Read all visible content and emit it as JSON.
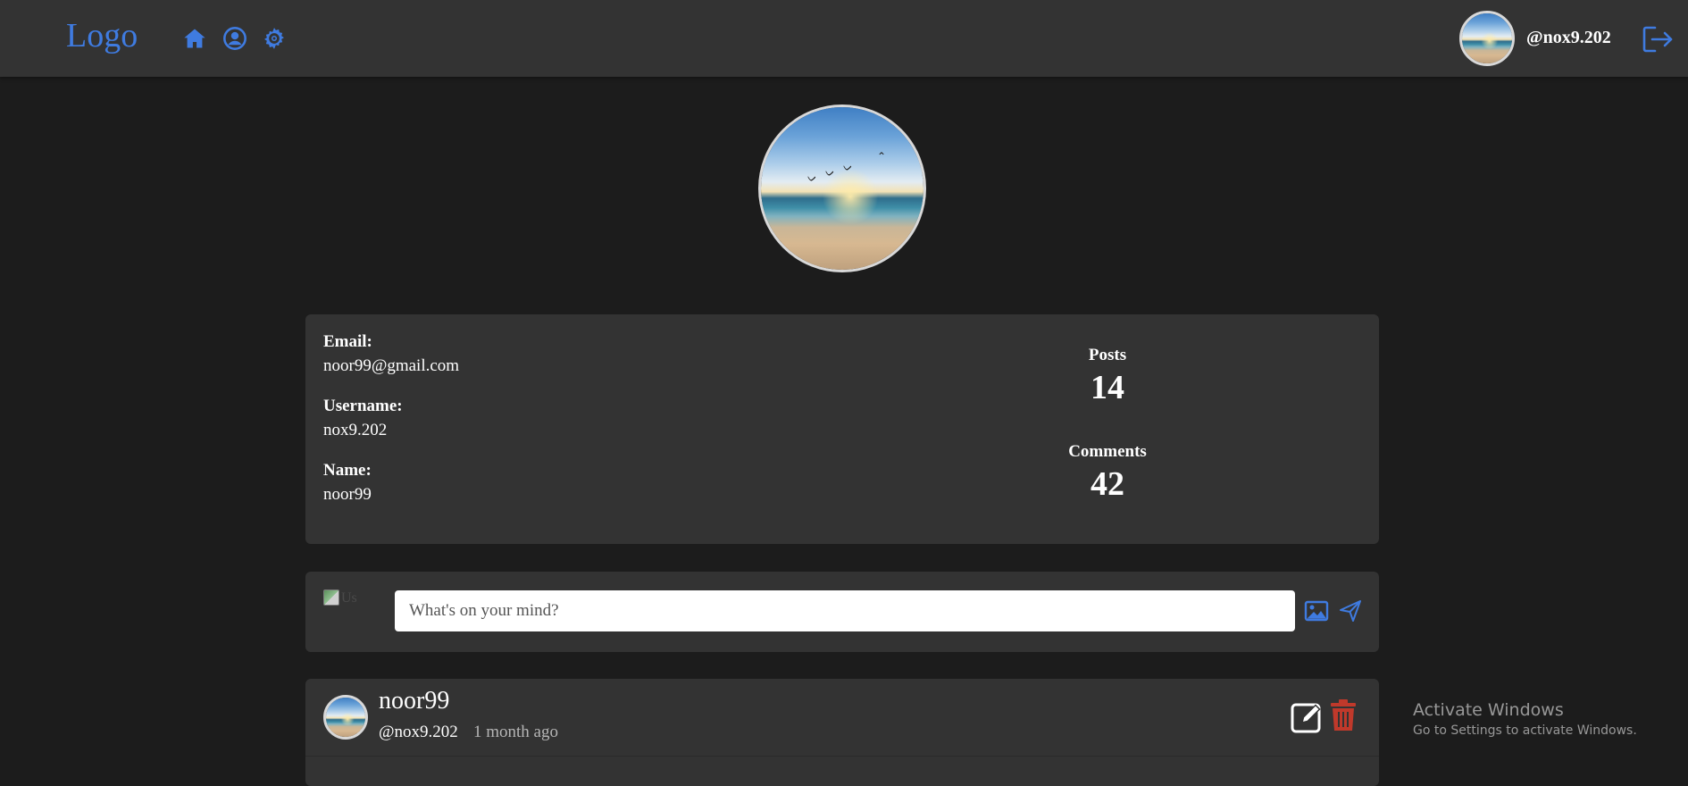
{
  "nav": {
    "logo": "Logo",
    "username": "@nox9.202",
    "icons": [
      "home-icon",
      "profile-icon",
      "settings-icon",
      "logout-icon"
    ]
  },
  "profile": {
    "email_label": "Email:",
    "email": "noor99@gmail.com",
    "username_label": "Username:",
    "username": "nox9.202",
    "name_label": "Name:",
    "name": "noor99",
    "posts_label": "Posts",
    "posts": "14",
    "comments_label": "Comments",
    "comments": "42"
  },
  "composer": {
    "avatar_alt": "Us",
    "placeholder": "What's on your mind?"
  },
  "post": {
    "author": "noor99",
    "handle": "@nox9.202",
    "time": "1 month ago"
  },
  "watermark": {
    "title": "Activate Windows",
    "subtitle": "Go to Settings to activate Windows."
  },
  "colors": {
    "accent": "#3f7be0",
    "delete": "#c0392b",
    "background": "#1c1c1c",
    "card": "#333333"
  }
}
